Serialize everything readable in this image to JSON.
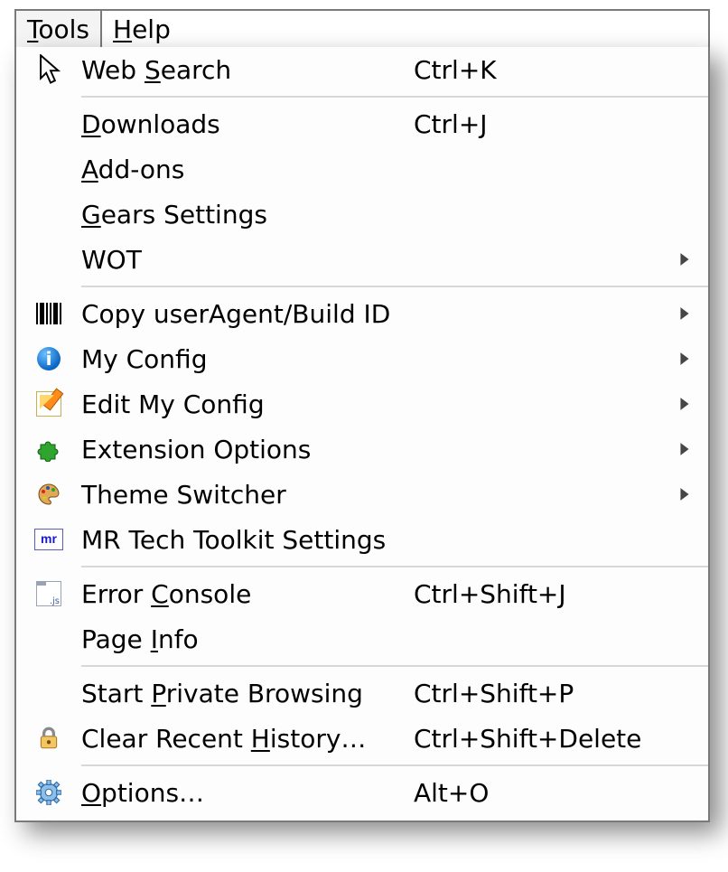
{
  "menubar": {
    "tools": {
      "pre": "",
      "u": "T",
      "post": "ools"
    },
    "help": {
      "pre": "",
      "u": "H",
      "post": "elp"
    }
  },
  "menu": {
    "web_search": {
      "pre": "Web ",
      "u": "S",
      "post": "earch",
      "shortcut": "Ctrl+K"
    },
    "downloads": {
      "pre": "",
      "u": "D",
      "post": "ownloads",
      "shortcut": "Ctrl+J"
    },
    "addons": {
      "pre": "",
      "u": "A",
      "post": "dd-ons"
    },
    "gears": {
      "pre": "",
      "u": "G",
      "post": "ears Settings"
    },
    "wot": {
      "label": "WOT"
    },
    "copy_ua": {
      "label": "Copy userAgent/Build ID"
    },
    "my_config": {
      "label": "My Config"
    },
    "edit_config": {
      "label": "Edit My Config"
    },
    "ext_options": {
      "label": "Extension Options"
    },
    "theme_switch": {
      "label": "Theme Switcher"
    },
    "mr_toolkit": {
      "label": "MR Tech Toolkit Settings"
    },
    "error_console": {
      "pre": "Error ",
      "u": "C",
      "post": "onsole",
      "shortcut": "Ctrl+Shift+J"
    },
    "page_info": {
      "pre": "Page ",
      "u": "I",
      "post": "nfo"
    },
    "private": {
      "pre": "Start ",
      "u": "P",
      "post": "rivate Browsing",
      "shortcut": "Ctrl+Shift+P"
    },
    "clear_hist": {
      "pre": "Clear Recent ",
      "u": "H",
      "post": "istory…",
      "shortcut": "Ctrl+Shift+Delete"
    },
    "options": {
      "pre": "",
      "u": "O",
      "post": "ptions…",
      "shortcut": "Alt+O"
    }
  }
}
